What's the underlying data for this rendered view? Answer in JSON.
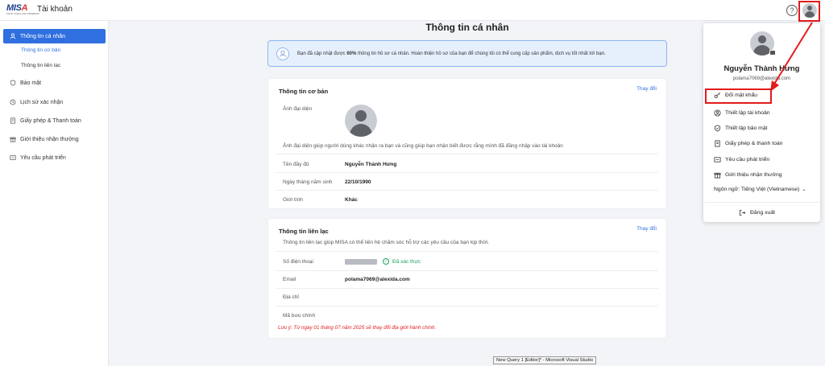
{
  "header": {
    "logo_text": "MISA",
    "logo_subtext": "TRUST TODAY FOR TOMORROW",
    "app_title": "Tài khoản"
  },
  "sidebar": {
    "items": [
      {
        "label": "Thông tin cá nhân",
        "active": true
      },
      {
        "label": "Bảo mật"
      },
      {
        "label": "Lịch sử xác nhận"
      },
      {
        "label": "Giấy phép & Thanh toán"
      },
      {
        "label": "Giới thiệu nhận thưởng"
      },
      {
        "label": "Yêu cầu phát triển"
      }
    ],
    "sub_items": [
      {
        "label": "Thông tin cơ bản",
        "active": true
      },
      {
        "label": "Thông tin liên lạc"
      }
    ]
  },
  "main": {
    "page_title": "Thông tin cá nhân",
    "banner": {
      "prefix": "Bạn đã cập nhật được ",
      "percent": "60%",
      "suffix": " thông tin hồ sơ cá nhân. Hoàn thiện hồ sơ của bạn để chúng tôi có thể cung cấp sản phẩm, dịch vụ tốt nhất tới bạn."
    },
    "basic": {
      "title": "Thông tin cơ bản",
      "edit": "Thay đổi",
      "avatar_label": "Ảnh đại diện",
      "avatar_help": "Ảnh đại diện giúp người dùng khác nhận ra bạn và cũng giúp bạn nhận biết được rằng mình đã đăng nhập vào tài khoản",
      "rows": [
        {
          "label": "Tên đầy đủ",
          "value": "Nguyễn Thành Hưng"
        },
        {
          "label": "Ngày tháng năm sinh",
          "value": "22/10/1990"
        },
        {
          "label": "Giới tính",
          "value": "Khác"
        }
      ]
    },
    "contact": {
      "title": "Thông tin liên lạc",
      "edit": "Thay đổi",
      "desc": "Thông tin liên lạc giúp MISA có thể liên hệ chăm sóc hỗ trợ các yêu cầu của bạn kịp thời.",
      "phone_label": "Số điện thoại",
      "verified": "Đã xác thực",
      "email_label": "Email",
      "email_value": "polama7069@alexida.com",
      "address_label": "Địa chỉ",
      "postal_label": "Mã bưu chính",
      "note": "Lưu ý: Từ ngày 01 tháng 07 năm 2025 sẽ thay đổi địa giới hành chính."
    }
  },
  "account_menu": {
    "name": "Nguyễn Thành Hưng",
    "email": "polama7069@alexida.com",
    "items": [
      {
        "label": "Đổi mật khẩu",
        "icon": "key-icon"
      },
      {
        "label": "Thiết lập tài khoản",
        "icon": "user-circle-icon"
      },
      {
        "label": "Thiết lập bảo mật",
        "icon": "shield-icon"
      },
      {
        "label": "Giấy phép & thanh toán",
        "icon": "receipt-icon"
      },
      {
        "label": "Yêu cầu phát triển",
        "icon": "request-icon"
      },
      {
        "label": "Giới thiệu nhận thưởng",
        "icon": "gift-icon"
      }
    ],
    "language": "Ngôn ngữ: Tiếng Việt (Vietnamese)",
    "logout": "Đăng xuất"
  },
  "taskbar_tooltip": "New Query 1 [Editor]* - Microsoft Visual Studio",
  "colors": {
    "primary": "#2f6fdf",
    "highlight": "#e31b1b",
    "verified": "#19a35a",
    "banner_bg": "#e6f0fd"
  }
}
